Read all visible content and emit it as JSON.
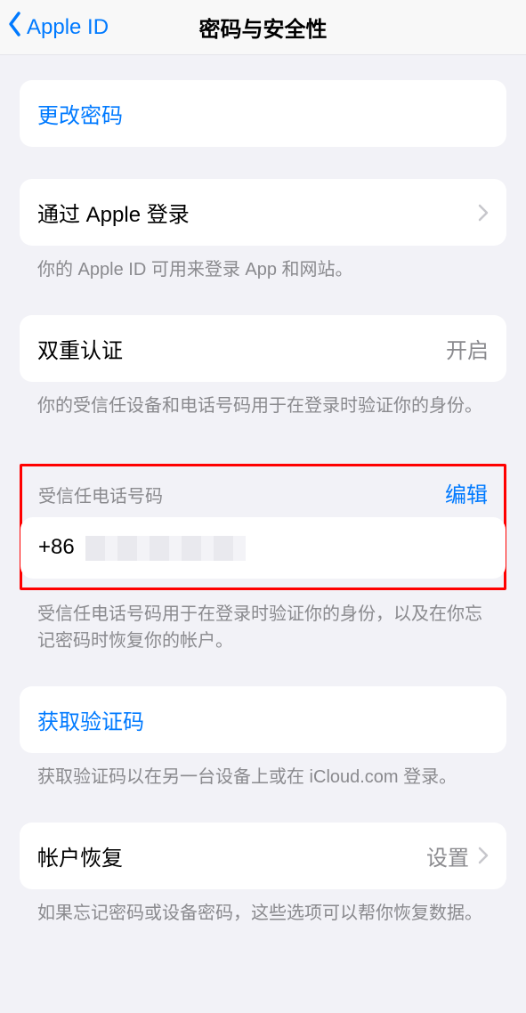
{
  "nav": {
    "back_label": "Apple ID",
    "title": "密码与安全性"
  },
  "change_password": {
    "label": "更改密码"
  },
  "sign_in_apple": {
    "label": "通过 Apple 登录",
    "footer": "你的 Apple ID 可用来登录 App 和网站。"
  },
  "two_factor": {
    "label": "双重认证",
    "value": "开启",
    "footer": "你的受信任设备和电话号码用于在登录时验证你的身份。"
  },
  "trusted_phone": {
    "header": "受信任电话号码",
    "edit": "编辑",
    "number_prefix": "+86",
    "footer": "受信任电话号码用于在登录时验证你的身份，以及在你忘记密码时恢复你的帐户。"
  },
  "get_code": {
    "label": "获取验证码",
    "footer": "获取验证码以在另一台设备上或在 iCloud.com 登录。"
  },
  "account_recovery": {
    "label": "帐户恢复",
    "value": "设置",
    "footer": "如果忘记密码或设备密码，这些选项可以帮你恢复数据。"
  }
}
